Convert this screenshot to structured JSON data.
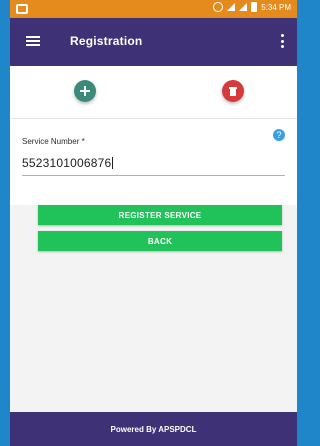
{
  "statusbar": {
    "time": "5:34 PM"
  },
  "appbar": {
    "title": "Registration"
  },
  "form": {
    "label": "Service Number *",
    "value": "5523101006876"
  },
  "buttons": {
    "register": "REGISTER SERVICE",
    "back": "BACK"
  },
  "footer": {
    "text": "Powered By APSPDCL"
  },
  "colors": {
    "status_bar": "#e58a1d",
    "app_bar": "#3f3176",
    "button_green": "#22c25a",
    "add_teal": "#3c8a7b",
    "delete_red": "#d63a3a",
    "help_blue": "#3aa0e6"
  }
}
